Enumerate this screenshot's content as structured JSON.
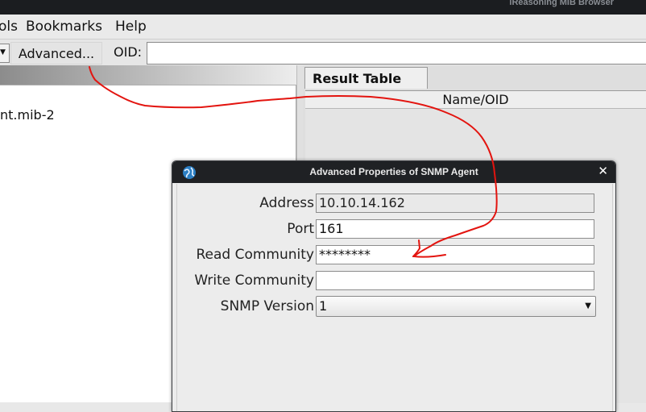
{
  "app": {
    "title": "iReasoning MIB Browser"
  },
  "menubar": {
    "items": [
      "ols",
      "Bookmarks",
      "Help"
    ]
  },
  "toolbar": {
    "advanced_label": "Advanced...",
    "oid_label": "OID:",
    "oid_value": ""
  },
  "tree": {
    "item": "nt.mib-2"
  },
  "results": {
    "tab_label": "Result Table",
    "column_header": "Name/OID"
  },
  "dialog": {
    "title": "Advanced Properties of SNMP Agent",
    "close_glyph": "✕",
    "address_label": "Address",
    "address_value": "10.10.14.162",
    "port_label": "Port",
    "port_value": "161",
    "read_community_label": "Read Community",
    "read_community_value": "********",
    "write_community_label": "Write Community",
    "write_community_value": "",
    "snmp_version_label": "SNMP Version",
    "snmp_version_value": "1"
  },
  "annotation": {
    "color": "#e3140f"
  },
  "icons": {
    "dropdown": "chevron-down-icon",
    "app": "globe-icon",
    "close": "close-icon"
  }
}
